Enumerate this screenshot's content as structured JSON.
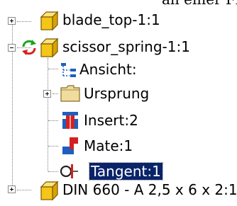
{
  "caption_fragment": "an einer Fläche der Beweg",
  "tree": {
    "items": [
      {
        "label": "blade_top-1:1",
        "icon": "part-icon",
        "expander": "plus"
      },
      {
        "label": "scissor_spring-1:1",
        "icon": "part-icon",
        "status_icon": "adaptive-refresh-icon",
        "expander": "minus"
      },
      {
        "label": "Ansicht:",
        "icon": "view-icon"
      },
      {
        "label": "Ursprung",
        "icon": "folder-icon",
        "expander": "plus"
      },
      {
        "label": "Insert:2",
        "icon": "insert-constraint-icon"
      },
      {
        "label": "Mate:1",
        "icon": "mate-constraint-icon"
      },
      {
        "label": "Tangent:1",
        "icon": "tangent-constraint-icon",
        "selected": true
      },
      {
        "label": "DIN 660 - A 2,5 x 6 x 2:1",
        "icon": "part-icon",
        "expander": "plus"
      }
    ]
  },
  "colors": {
    "selection_bg": "#0a246a",
    "selection_text": "#ffffff",
    "part_yellow": "#f5c518",
    "folder_tan": "#f0dc9c",
    "constraint_red": "#d42020",
    "constraint_blue": "#1c5fbf"
  }
}
